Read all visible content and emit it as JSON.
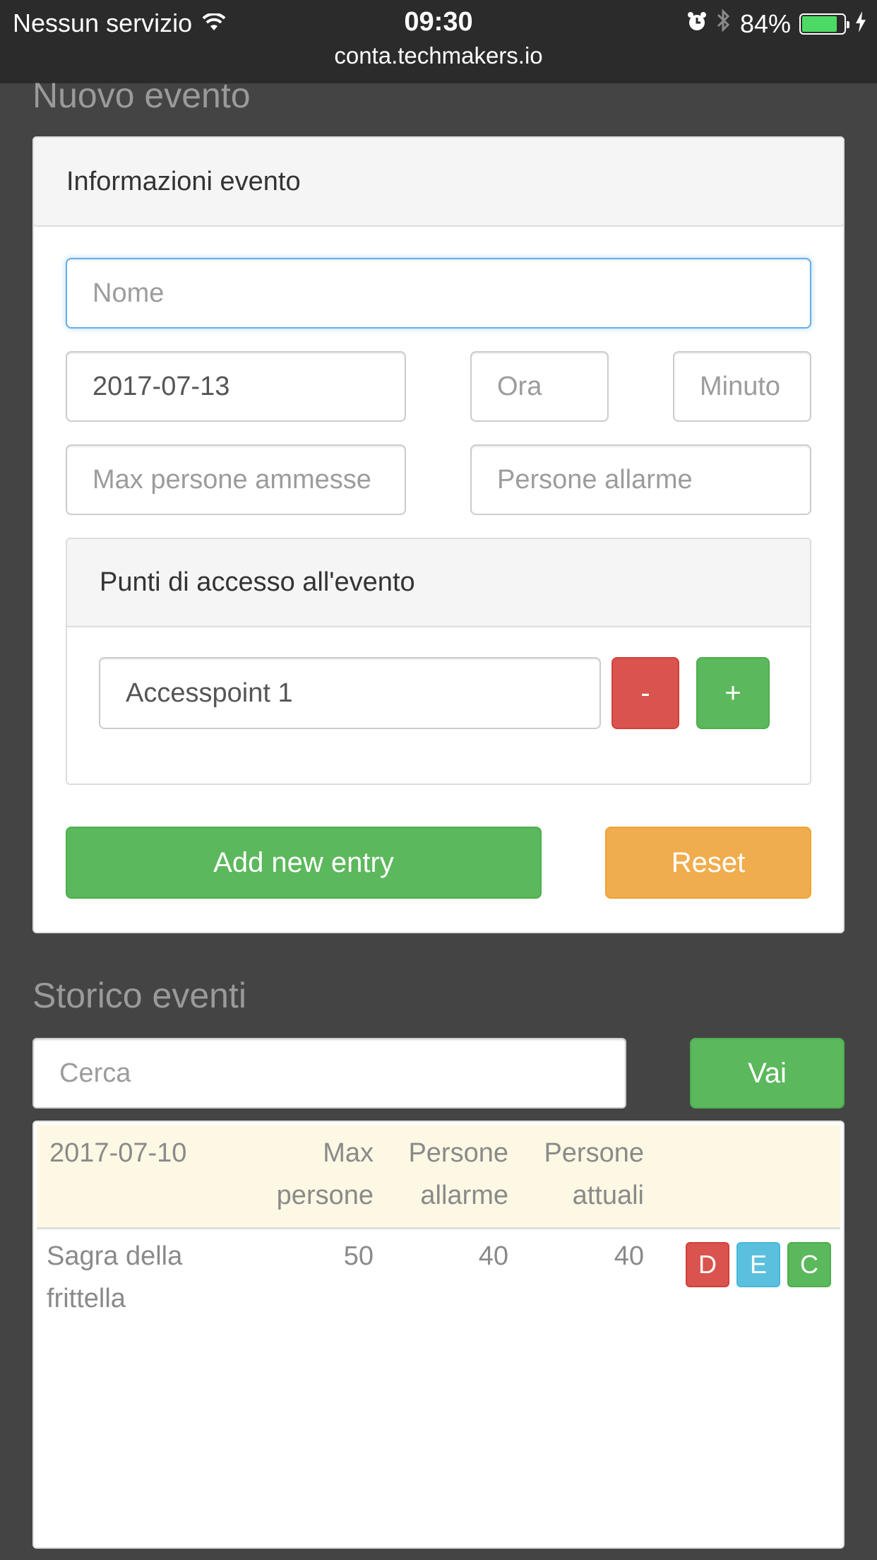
{
  "status_bar": {
    "carrier": "Nessun servizio",
    "time": "09:30",
    "battery": "84%",
    "battery_level": 0.84,
    "url": "conta.techmakers.io"
  },
  "new_event": {
    "title": "Nuovo evento",
    "panel_heading": "Informazioni evento",
    "name_placeholder": "Nome",
    "date_value": "2017-07-13",
    "hour_placeholder": "Ora",
    "minute_placeholder": "Minuto",
    "max_people_placeholder": "Max persone ammesse",
    "alarm_people_placeholder": "Persone allarme",
    "access_points": {
      "heading": "Punti di accesso all'evento",
      "items": [
        {
          "value": "Accesspoint 1",
          "remove_label": "-",
          "add_label": "+"
        }
      ]
    },
    "add_label": "Add new entry",
    "reset_label": "Reset"
  },
  "history": {
    "title": "Storico eventi",
    "search_placeholder": "Cerca",
    "go_label": "Vai",
    "table": {
      "header": {
        "date": "2017-07-10",
        "max_people": [
          "Max",
          "persone"
        ],
        "alarm_people": [
          "Persone",
          "allarme"
        ],
        "current_people": [
          "Persone",
          "attuali"
        ]
      },
      "rows": [
        {
          "name": [
            "Sagra della",
            "frittella"
          ],
          "max_people": "50",
          "alarm_people": "40",
          "current_people": "40",
          "actions": [
            "D",
            "E",
            "C"
          ]
        }
      ]
    }
  },
  "colors": {
    "background": "#444444",
    "success": "#5cb85c",
    "danger": "#d9534f",
    "warning": "#f0ad4e",
    "info": "#5bc0de",
    "focus": "#66afe9"
  }
}
